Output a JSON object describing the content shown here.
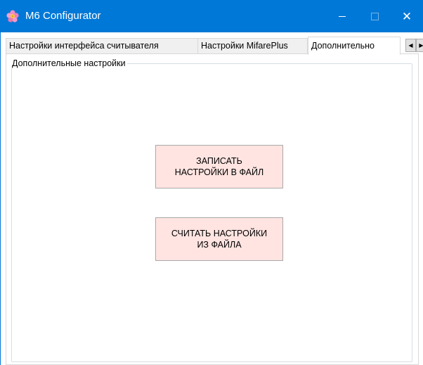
{
  "window": {
    "title": "M6 Configurator",
    "accent_color": "#0078d7",
    "icon": "flower-icon",
    "controls": {
      "minimize": "minimize-icon",
      "maximize": "maximize-icon",
      "close": "close-icon",
      "close_glyph": "✕"
    }
  },
  "tabs": [
    {
      "label": "Настройки интерфейса считывателя",
      "selected": false
    },
    {
      "label": "Настройки MifarePlus",
      "selected": false
    },
    {
      "label": "Дополнительно",
      "selected": true
    }
  ],
  "tab_scroll": {
    "left": "◀",
    "right": "▶"
  },
  "panel": {
    "group_title": "Дополнительные настройки",
    "buttons": {
      "write_label": "ЗАПИСАТЬ\nНАСТРОЙКИ В ФАЙЛ",
      "read_label": "СЧИТАТЬ НАСТРОЙКИ\nИЗ ФАЙЛА",
      "background": "#ffe4e1"
    }
  }
}
